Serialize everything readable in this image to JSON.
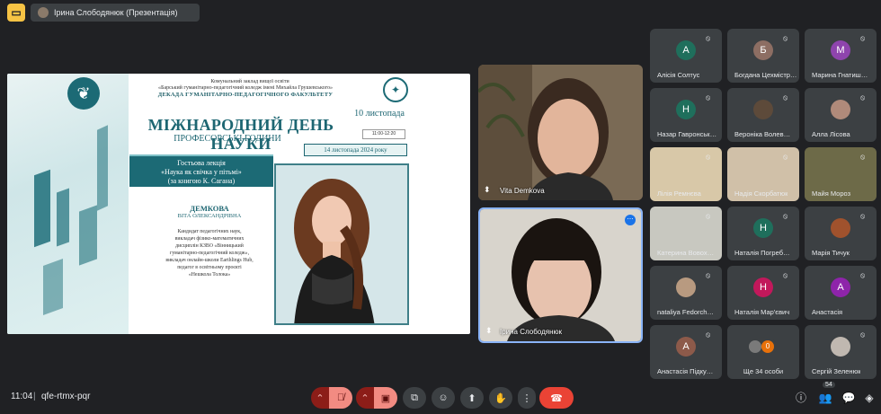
{
  "top": {
    "presenter_chip": "Ірина Слободянюк (Презентація)"
  },
  "slide": {
    "inst1": "Комунальний заклад вищої освіти",
    "inst2": "«Барський гуманітарно-педагогічний коледж імені Михайла Грушевського»",
    "dept": "ДЕКАДА ГУМАНІТАРНО-ПЕДАГОГІЧНОГО ФАКУЛЬТЕТУ",
    "date_top": "10 листопада",
    "title": "МІЖНАРОДНИЙ ДЕНЬ НАУКИ",
    "subtitle": "ПРОФЕСОРСЬКІ ГОДИНИ",
    "time": "11:00-12:20",
    "date_box": "14 листопада 2024 року",
    "lecture_l1": "Гостьова лекція",
    "lecture_l2": "«Наука як свічка у пітьмі»",
    "lecture_l3": "(за книгою К. Сагана)",
    "name_last": "ДЕМКОВА",
    "name_first": "ВІТА ОЛЕКСАНДРІВНА",
    "desc": [
      "Кандидат педагогічних наук,",
      "викладач фізико-математичних",
      "дисциплін КЗВО «Вінницький",
      "гуманітарно-педагогічний коледж»,",
      "викладач онлайн-школи Earthlings Hub,",
      "педагог в освітньому проєкті",
      "«Нешкола Толока»"
    ]
  },
  "main_tiles": [
    {
      "name": "Vita Demkova"
    },
    {
      "name": "Ірина Слободянюк"
    }
  ],
  "participants": [
    {
      "name": "Алісія Солтус",
      "initial": "А",
      "color": "#1f6f5c"
    },
    {
      "name": "Богдана Цехмістр…",
      "initial": "Б",
      "color": "#8d6e63"
    },
    {
      "name": "Марина Гнатиш…",
      "initial": "М",
      "color": "#8e44ad"
    },
    {
      "name": "Назар Гавронськ…",
      "initial": "Н",
      "color": "#1f6f5c"
    },
    {
      "name": "Вероніка Волев…",
      "initial": "",
      "color": "#5d4a3a"
    },
    {
      "name": "Алла Лісова",
      "initial": "",
      "color": "#b08a7a"
    },
    {
      "name": "Лілія Ремнєва",
      "initial": "",
      "color": "#d8c8a8"
    },
    {
      "name": "Надія Скорбатюк",
      "initial": "",
      "color": "#d0c0a8"
    },
    {
      "name": "Майя Мороз",
      "initial": "",
      "color": "#6d6a48"
    },
    {
      "name": "Катерина Вовох…",
      "initial": "",
      "color": "#c8c8c0"
    },
    {
      "name": "Наталія Погреб…",
      "initial": "Н",
      "color": "#1f6f5c"
    },
    {
      "name": "Марія Тичук",
      "initial": "",
      "color": "#a0522d"
    },
    {
      "name": "nataliya Fedorch…",
      "initial": "",
      "color": "#b89a80"
    },
    {
      "name": "Наталія Мар'євич",
      "initial": "Н",
      "color": "#c2185b"
    },
    {
      "name": "Анастасія",
      "initial": "А",
      "color": "#8e24aa"
    },
    {
      "name": "Анастасія Підку…",
      "initial": "А",
      "color": "#8d5a4a"
    },
    {
      "name": "Ще 34 особи",
      "initial": "",
      "color": "#3c4043"
    },
    {
      "name": "Сергій Зеленюк",
      "initial": "",
      "color": "#c0b8b0"
    }
  ],
  "more_count_badge": "0",
  "bottom": {
    "time": "11:04",
    "separator": "|",
    "meeting_code": "qfe-rtmx-pqr",
    "people_count": "54"
  }
}
